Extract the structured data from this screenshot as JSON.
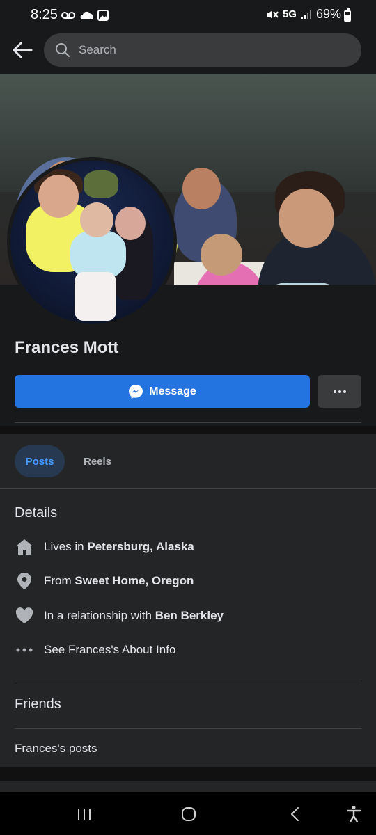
{
  "status_bar": {
    "time": "8:25",
    "network": "5G",
    "battery": "69%"
  },
  "search": {
    "placeholder": "Search"
  },
  "profile": {
    "name": "Frances Mott"
  },
  "actions": {
    "message_label": "Message"
  },
  "tabs": [
    {
      "label": "Posts",
      "active": true
    },
    {
      "label": "Reels",
      "active": false
    }
  ],
  "details": {
    "title": "Details",
    "lives_prefix": "Lives in ",
    "lives_value": "Petersburg, Alaska",
    "from_prefix": "From ",
    "from_value": "Sweet Home, Oregon",
    "relationship_prefix": "In a relationship with ",
    "relationship_value": "Ben Berkley",
    "about_label": "See Frances's About Info"
  },
  "friends": {
    "title": "Friends"
  },
  "posts_link": "Frances's posts",
  "colors": {
    "background": "#18191a",
    "card": "#242526",
    "accent": "#2374e1",
    "active_tab_bg": "#263951",
    "active_tab_text": "#4599ff"
  },
  "icons": [
    "back-arrow-icon",
    "search-icon",
    "messenger-icon",
    "more-icon",
    "home-icon",
    "location-pin-icon",
    "heart-icon",
    "ellipsis-icon",
    "recent-apps-icon",
    "home-nav-icon",
    "back-nav-icon",
    "accessibility-icon"
  ]
}
